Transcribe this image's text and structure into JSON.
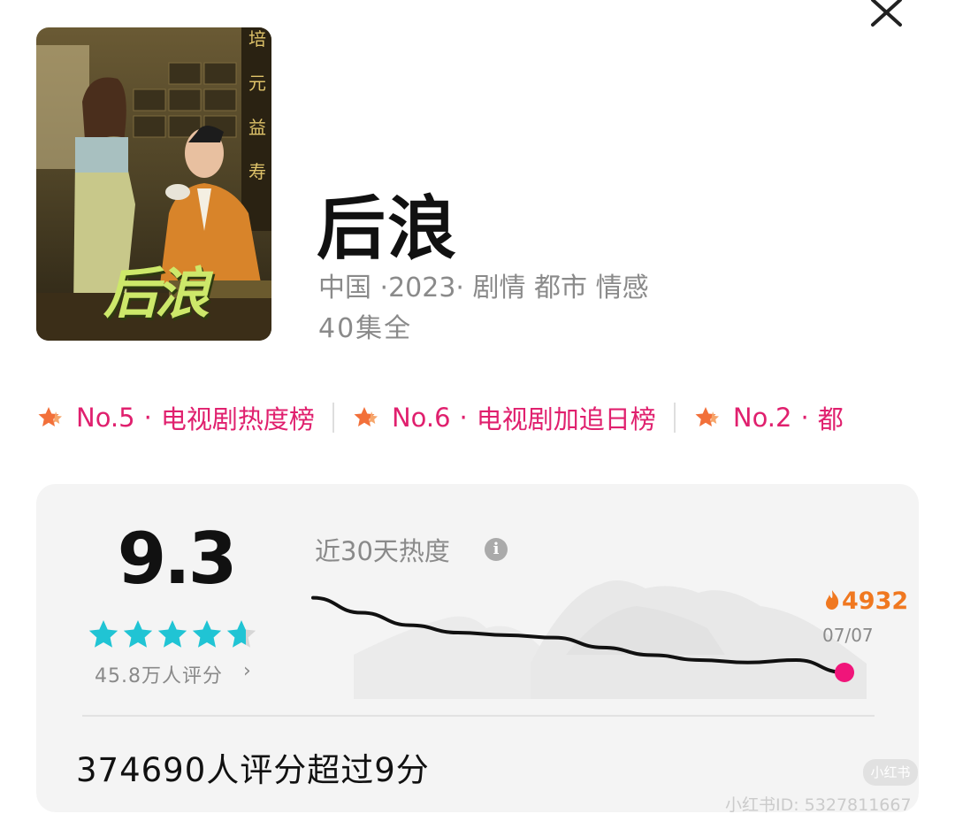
{
  "show": {
    "title": "后浪",
    "poster_title": "后浪",
    "meta_line": "中国 ·2023· 剧情 都市 情感",
    "episodes": "40集全"
  },
  "rankings": [
    {
      "number": "No.5",
      "dot": "·",
      "name": "电视剧热度榜"
    },
    {
      "number": "No.6",
      "dot": "·",
      "name": "电视剧加追日榜"
    },
    {
      "number": "No.2",
      "dot": "·",
      "name": "都"
    }
  ],
  "rating": {
    "score": "9.3",
    "stars_value": 4.65,
    "stars_max": 5,
    "count_label": "45.8万人评分",
    "chevron": "›",
    "over_nine": "374690人评分超过9分"
  },
  "heat": {
    "title": "近30天热度",
    "info_glyph": "i",
    "value": "4932",
    "date": "07/07"
  },
  "chart_data": {
    "type": "line",
    "title": "近30天热度",
    "series": [
      {
        "values": [
          9.0,
          8.4,
          7.9,
          7.6,
          7.5,
          7.4,
          7.0,
          6.7,
          6.5,
          6.4,
          6.5,
          6.0
        ]
      }
    ],
    "last_point_label": "4932",
    "last_point_date": "07/07"
  },
  "watermark": {
    "logo_text": "小红书",
    "id_text": "小红书ID: 5327811667"
  },
  "colors": {
    "accent_pink": "#e0206e",
    "heat_orange": "#f07820",
    "star_teal": "#20c4d4",
    "card_bg": "#f4f4f4"
  },
  "icons": {
    "close": "close-icon",
    "rank": "rank-star-icon",
    "info": "info-icon",
    "fire": "fire-icon"
  }
}
